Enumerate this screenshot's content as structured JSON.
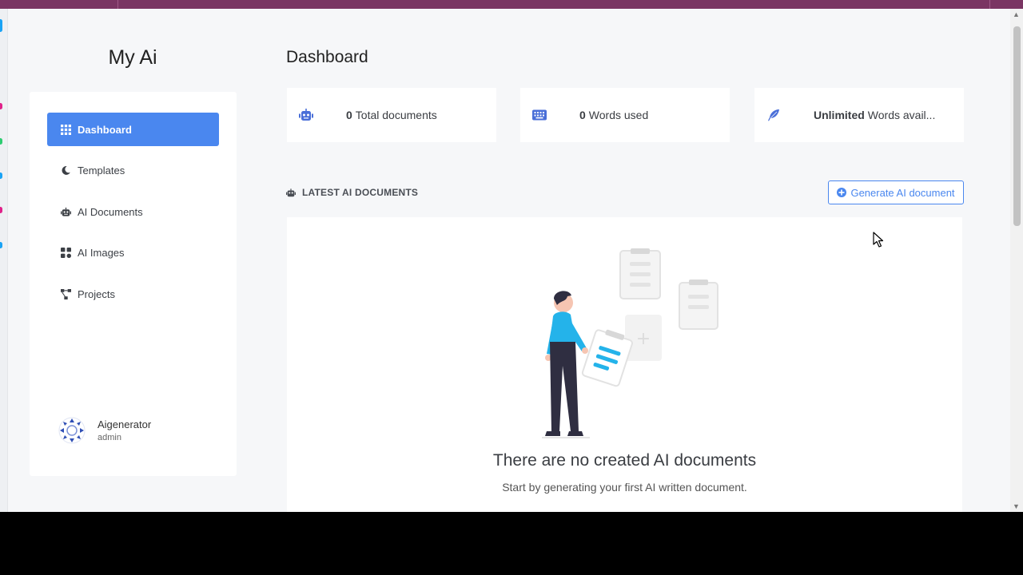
{
  "app": {
    "brand": "My Ai"
  },
  "sidebar": {
    "items": [
      {
        "label": "Dashboard",
        "icon": "grid-icon",
        "active": true
      },
      {
        "label": "Templates",
        "icon": "moon-icon",
        "active": false
      },
      {
        "label": "AI Documents",
        "icon": "robot-icon",
        "active": false
      },
      {
        "label": "AI Images",
        "icon": "images-icon",
        "active": false
      },
      {
        "label": "Projects",
        "icon": "project-diagram-icon",
        "active": false
      }
    ],
    "user": {
      "name": "Aigenerator",
      "role": "admin"
    }
  },
  "header": {
    "title": "Dashboard"
  },
  "stats": [
    {
      "value": "0",
      "label": "Total documents",
      "icon": "robot-icon"
    },
    {
      "value": "0",
      "label": "Words used",
      "icon": "keyboard-icon"
    },
    {
      "value": "Unlimited",
      "label": "Words avail...",
      "icon": "feather-icon"
    }
  ],
  "documents": {
    "heading": "LATEST AI DOCUMENTS",
    "generate_label": "Generate AI document",
    "empty_title": "There are no created AI documents",
    "empty_subtitle": "Start by generating your first AI written document."
  },
  "colors": {
    "accent": "#4a87ef",
    "top_bar": "#7a3563",
    "figure_accent": "#24b3ea"
  }
}
